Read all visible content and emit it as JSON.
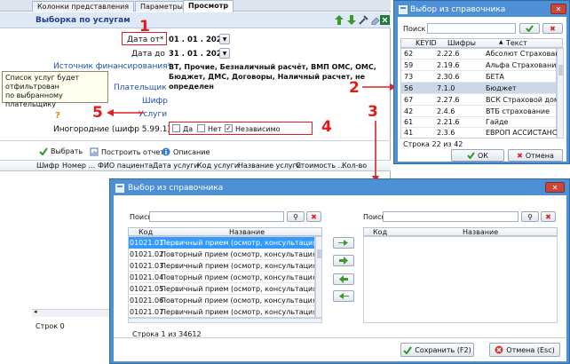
{
  "main": {
    "tabs": [
      "Колонки представления",
      "Параметры",
      "Просмотр"
    ],
    "section_title": "Выборка по услугам",
    "date_from_label": "Дата от*",
    "date_from_value": "01 . 01 . 2022",
    "date_to_label": "Дата до",
    "date_to_value": "31 . 01 . 2022",
    "funding_label": "Источник финансирования*",
    "funding_value": "ВТ, Прочие, Безналичный расчёт, ВМП ОМС, ОМС, Бюджет, ДМС, Договоры, Наличный расчет, не определен",
    "payer_label": "Плательщик",
    "code_label": "Шифр",
    "services_label": "Услуги",
    "foreign_label": "Иногородние (шифр 5.99.1)",
    "opt_yes": "Да",
    "opt_no": "Нет",
    "opt_any": "Независимо",
    "question_mark": "?",
    "select_btn": "Выбрать",
    "report_btn": "Построить отчет",
    "desc_btn": "Описание",
    "columns": [
      "Шифр",
      "Номер ...",
      "ФИО пациента",
      "Дата услуги",
      "Код услуги",
      "Название услуги",
      "Стоимость ...",
      "Кол-во"
    ],
    "status": "Строк 0"
  },
  "tooltip": {
    "lines": [
      "Список услуг будет",
      "отфильтрован",
      "по выбранному плательщику"
    ]
  },
  "callouts": {
    "n1": "1",
    "n2": "2",
    "n3": "3",
    "n4": "4",
    "n5": "5"
  },
  "dict_small": {
    "title": "Выбор из справочника",
    "search_label": "Поиск",
    "col_keyid": "KEYID",
    "col_codes": "Шифры",
    "col_text": "Текст",
    "rows": [
      {
        "id": "62",
        "code": "2.22.6",
        "text": "Абсолют Страхование"
      },
      {
        "id": "59",
        "code": "2.19.6",
        "text": "Альфа Страхование"
      },
      {
        "id": "73",
        "code": "2.30.6",
        "text": "БЕТА"
      },
      {
        "id": "56",
        "code": "7.1.0",
        "text": "Бюджет"
      },
      {
        "id": "67",
        "code": "2.27.6",
        "text": "ВСК Страховой дом"
      },
      {
        "id": "42",
        "code": "2.4.6",
        "text": "ВТБ страхование"
      },
      {
        "id": "61",
        "code": "2.21.6",
        "text": "Гайде"
      },
      {
        "id": "41",
        "code": "2.3.6",
        "text": "ЕВРОП АССИСТАНС ..."
      }
    ],
    "status": "Строка 22 из 42",
    "ok_btn": "ОК",
    "cancel_btn": "Отмена"
  },
  "dict_big": {
    "title": "Выбор из справочника",
    "search_label": "Поиск:",
    "col_code": "Код",
    "col_name": "Название",
    "rows": [
      {
        "code": "01021.01",
        "name": "Первичный прием (осмотр, консультация) вр..."
      },
      {
        "code": "01021.02",
        "name": "Повторный прием (осмотр, консультация) вр..."
      },
      {
        "code": "01021.03",
        "name": "Первичный прием (осмотр, консультация) вр..."
      },
      {
        "code": "01021.04",
        "name": "Повторный прием (осмотр, консультация) вр..."
      },
      {
        "code": "01021.05",
        "name": "Первичный прием (осмотр, консультация) вр..."
      },
      {
        "code": "01021.06",
        "name": "Повторный прием (осмотр, консультация) вр..."
      },
      {
        "code": "01021.07",
        "name": "Первичный прием (осмотр, консультация) вр..."
      }
    ],
    "status": "Строка 1 из 34612",
    "save_btn": "Сохранить (F2)",
    "cancel_btn": "Отмена (Esc)"
  },
  "colors": {
    "accent_red": "#e02020",
    "header_blue": "#dfe8f5",
    "selected_blue": "#3399ff",
    "window_blue": "#4d90d6"
  }
}
